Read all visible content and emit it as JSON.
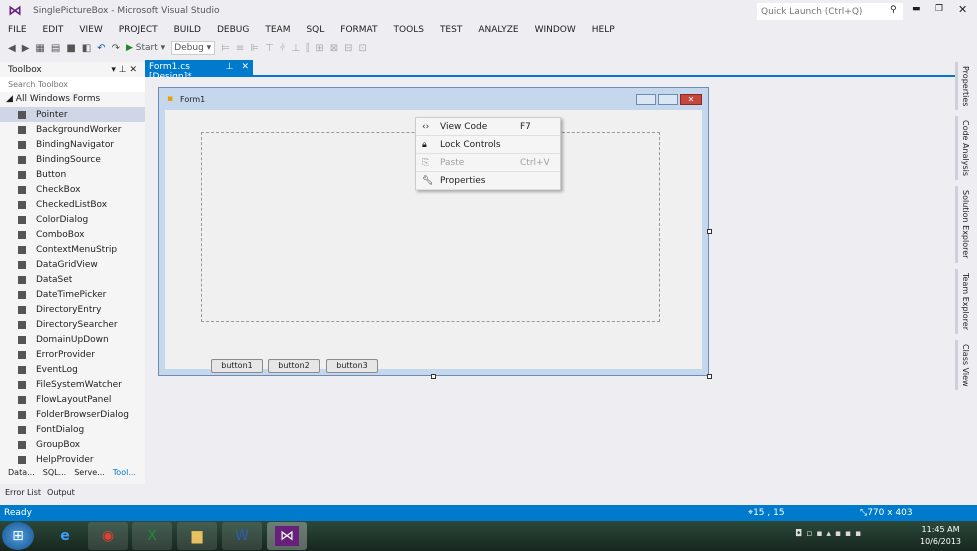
{
  "window": {
    "title": "SinglePictureBox - Microsoft Visual Studio",
    "quick_launch_placeholder": "Quick Launch (Ctrl+Q)"
  },
  "menu": [
    "FILE",
    "EDIT",
    "VIEW",
    "PROJECT",
    "BUILD",
    "DEBUG",
    "TEAM",
    "SQL",
    "FORMAT",
    "TOOLS",
    "TEST",
    "ANALYZE",
    "WINDOW",
    "HELP"
  ],
  "toolbar": {
    "start_label": "Start",
    "config": "Debug"
  },
  "doc_tab": {
    "label": "Form1.cs [Design]*"
  },
  "toolbox": {
    "title": "Toolbox",
    "search_placeholder": "Search Toolbox",
    "group": "All Windows Forms",
    "items": [
      "Pointer",
      "BackgroundWorker",
      "BindingNavigator",
      "BindingSource",
      "Button",
      "CheckBox",
      "CheckedListBox",
      "ColorDialog",
      "ComboBox",
      "ContextMenuStrip",
      "DataGridView",
      "DataSet",
      "DateTimePicker",
      "DirectoryEntry",
      "DirectorySearcher",
      "DomainUpDown",
      "ErrorProvider",
      "EventLog",
      "FileSystemWatcher",
      "FlowLayoutPanel",
      "FolderBrowserDialog",
      "FontDialog",
      "GroupBox",
      "HelpProvider"
    ],
    "bottom_tabs": [
      "Data...",
      "SQL...",
      "Serve...",
      "Tool..."
    ]
  },
  "form": {
    "title": "Form1",
    "buttons": [
      "button1",
      "button2",
      "button3"
    ]
  },
  "context_menu": [
    {
      "label": "View Code",
      "shortcut": "F7",
      "icon": "code-icon"
    },
    {
      "label": "Lock Controls",
      "shortcut": "",
      "icon": "lock-icon"
    },
    {
      "label": "Paste",
      "shortcut": "Ctrl+V",
      "icon": "paste-icon",
      "disabled": true
    },
    {
      "label": "Properties",
      "shortcut": "",
      "icon": "wrench-icon"
    }
  ],
  "right_tabs": [
    "Properties",
    "Code Analysis",
    "Solution Explorer",
    "Team Explorer",
    "Class View"
  ],
  "bottom_panel_tabs": [
    "Error List",
    "Output"
  ],
  "status": {
    "text": "Ready",
    "position": "15 , 15",
    "size": "770 x 403"
  },
  "taskbar": {
    "time": "11:45 AM",
    "date": "10/6/2013"
  },
  "colors": {
    "accent": "#007acc"
  }
}
